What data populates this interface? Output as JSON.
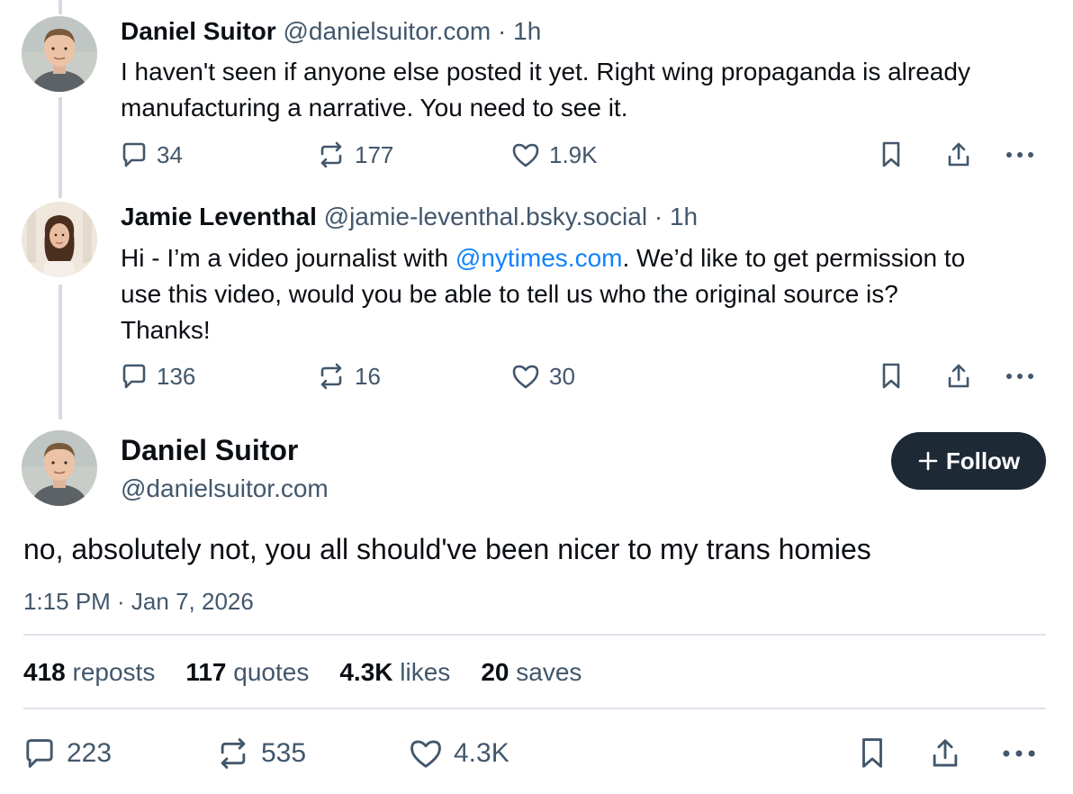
{
  "post1": {
    "author_name": "Daniel Suitor",
    "handle": "@danielsuitor.com",
    "separator": " · ",
    "time": "1h",
    "text": "I haven't seen if anyone else posted it yet. Right wing propaganda is already manufacturing a narrative. You need to see it.",
    "replies": "34",
    "reposts": "177",
    "likes": "1.9K"
  },
  "post2": {
    "author_name": "Jamie Leventhal",
    "handle": "@jamie-leventhal.bsky.social",
    "separator": " · ",
    "time": "1h",
    "text_before": "Hi - I’m a video journalist with ",
    "mention": "@nytimes.com",
    "text_after": ". We’d like to get permission to use this video, would you be able to tell us who the original source is? Thanks!",
    "replies": "136",
    "reposts": "16",
    "likes": "30"
  },
  "main_post": {
    "author_name": "Daniel Suitor",
    "handle": "@danielsuitor.com",
    "follow_label": "Follow",
    "text": "no, absolutely not, you all should've been nicer to my trans homies",
    "timestamp": "1:15 PM · Jan 7, 2026",
    "stats": {
      "reposts_count": "418",
      "reposts_label": "reposts",
      "quotes_count": "117",
      "quotes_label": "quotes",
      "likes_count": "4.3K",
      "likes_label": "likes",
      "saves_count": "20",
      "saves_label": "saves"
    },
    "replies": "223",
    "reposts": "535",
    "likes": "4.3K"
  },
  "colors": {
    "text": "#0b0f14",
    "muted": "#42576c",
    "link": "#1083fe",
    "follow_bg": "#1e2936",
    "thread_line": "#d4dbe2"
  },
  "icons": [
    "reply-icon",
    "repost-icon",
    "like-icon",
    "bookmark-icon",
    "share-icon",
    "more-icon",
    "plus-icon"
  ]
}
